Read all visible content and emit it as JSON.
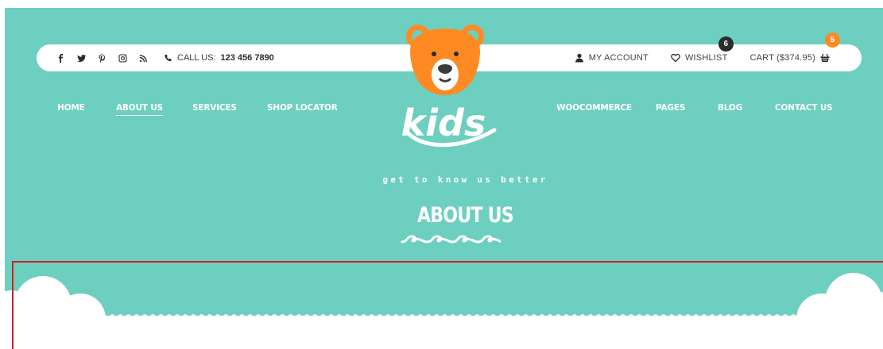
{
  "topbar": {
    "social_icons": [
      "facebook-icon",
      "twitter-icon",
      "pinterest-icon",
      "instagram-icon",
      "rss-icon"
    ],
    "call_label": "CALL US:",
    "call_number": "123 456 7890",
    "my_account": "MY ACCOUNT",
    "wishlist": "WISHLIST",
    "wishlist_count": "6",
    "cart": "CART ($374.95)",
    "cart_count": "5"
  },
  "nav": {
    "home": "HOME",
    "about": "ABOUT US",
    "services": "SERVICES",
    "shop_locator": "SHOP LOCATOR",
    "woocommerce": "WOOCOMMERCE",
    "pages": "PAGES",
    "blog": "BLOG",
    "contact": "CONTACT US"
  },
  "logo": {
    "text": "kids"
  },
  "hero": {
    "tagline": "get to know us better",
    "title": "ABOUT US"
  },
  "colors": {
    "background": "#6ccfbf",
    "bear_orange": "#ff8a24",
    "badge_dark": "#2b2b2b",
    "selection_border": "#d61f1f"
  }
}
